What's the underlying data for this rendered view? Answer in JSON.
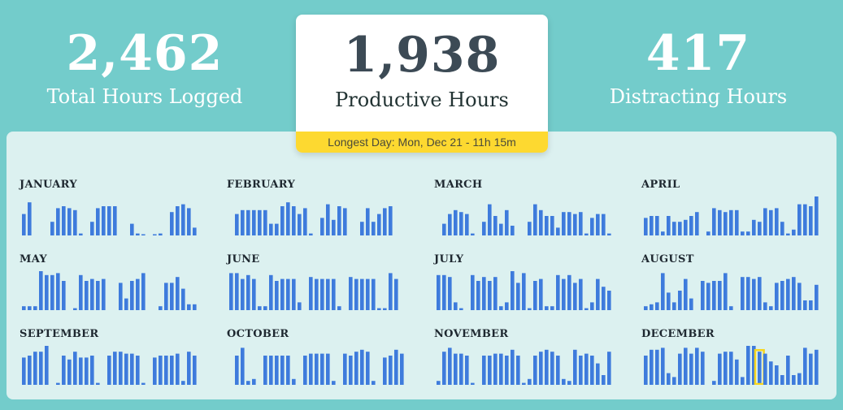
{
  "stats": {
    "total": {
      "value": "2,462",
      "label": "Total Hours Logged"
    },
    "productive": {
      "value": "1,938",
      "label": "Productive Hours",
      "longest_day": "Longest Day: Mon, Dec 21 - 11h 15m"
    },
    "distracting": {
      "value": "417",
      "label": "Distracting Hours"
    }
  },
  "colors": {
    "background": "#73cccb",
    "panel": "#dcf1f0",
    "bar": "#3e7bdc",
    "highlight": "#f7d51d",
    "banner": "#fdd930"
  },
  "highlight": {
    "month": "DECEMBER",
    "day": 21
  },
  "months": [
    {
      "name": "JANUARY",
      "values": [
        0.55,
        0.85,
        0,
        0,
        0,
        0.35,
        0.7,
        0.75,
        0.7,
        0.65,
        0.05,
        0,
        0.35,
        0.7,
        0.75,
        0.75,
        0.75,
        0,
        0,
        0.3,
        0.05,
        0.03,
        0,
        0.03,
        0.05,
        0,
        0.6,
        0.75,
        0.8,
        0.7,
        0.2
      ]
    },
    {
      "name": "FEBRUARY",
      "values": [
        0,
        0.55,
        0.65,
        0.65,
        0.65,
        0.65,
        0.65,
        0.3,
        0.3,
        0.75,
        0.85,
        0.75,
        0.55,
        0.7,
        0.05,
        0,
        0.45,
        0.8,
        0.4,
        0.75,
        0.7,
        0,
        0,
        0.35,
        0.7,
        0.35,
        0.55,
        0.7,
        0.75
      ]
    },
    {
      "name": "MARCH",
      "values": [
        0,
        0.3,
        0.55,
        0.65,
        0.6,
        0.55,
        0.05,
        0,
        0.35,
        0.8,
        0.5,
        0.3,
        0.65,
        0.25,
        0,
        0,
        0.35,
        0.8,
        0.65,
        0.5,
        0.5,
        0.2,
        0.6,
        0.6,
        0.55,
        0.6,
        0.05,
        0.45,
        0.55,
        0.55,
        0.05
      ]
    },
    {
      "name": "APRIL",
      "values": [
        0.45,
        0.5,
        0.5,
        0.1,
        0.5,
        0.35,
        0.35,
        0.4,
        0.5,
        0.6,
        0,
        0.1,
        0.7,
        0.65,
        0.6,
        0.65,
        0.65,
        0.1,
        0.1,
        0.4,
        0.35,
        0.7,
        0.65,
        0.7,
        0.35,
        0.05,
        0.15,
        0.8,
        0.8,
        0.75,
        1.0,
        0.75
      ]
    },
    {
      "name": "MAY",
      "values": [
        0.1,
        0.1,
        0.1,
        1.0,
        0.9,
        0.9,
        0.95,
        0.75,
        0,
        0.05,
        0.9,
        0.75,
        0.8,
        0.75,
        0.8,
        0,
        0,
        0.7,
        0.3,
        0.75,
        0.8,
        0.95,
        0,
        0,
        0.1,
        0.7,
        0.7,
        0.85,
        0.55,
        0.15,
        0.15
      ]
    },
    {
      "name": "JUNE",
      "values": [
        0.95,
        0.95,
        0.8,
        0.9,
        0.8,
        0.1,
        0.1,
        0.9,
        0.75,
        0.8,
        0.8,
        0.8,
        0.2,
        0,
        0.85,
        0.8,
        0.8,
        0.8,
        0.8,
        0.1,
        0,
        0.85,
        0.8,
        0.8,
        0.8,
        0.8,
        0.05,
        0.05,
        0.95,
        0.8
      ]
    },
    {
      "name": "JULY",
      "values": [
        0.9,
        0.9,
        0.85,
        0.2,
        0.05,
        0,
        0.9,
        0.75,
        0.85,
        0.75,
        0.85,
        0.1,
        0.2,
        1.0,
        0.7,
        0.95,
        0.05,
        0.75,
        0.8,
        0.1,
        0.1,
        0.9,
        0.8,
        0.9,
        0.7,
        0.8,
        0.05,
        0.2,
        0.8,
        0.6,
        0.5
      ]
    },
    {
      "name": "AUGUST",
      "values": [
        0.1,
        0.15,
        0.2,
        0.95,
        0.45,
        0.2,
        0.5,
        0.8,
        0.3,
        0,
        0.75,
        0.7,
        0.75,
        0.75,
        0.95,
        0.1,
        0,
        0.85,
        0.85,
        0.8,
        0.85,
        0.2,
        0.1,
        0.7,
        0.75,
        0.8,
        0.85,
        0.7,
        0.25,
        0.25,
        0.65
      ]
    },
    {
      "name": "SEPTEMBER",
      "values": [
        0.7,
        0.75,
        0.85,
        0.85,
        1.0,
        0,
        0.05,
        0.75,
        0.65,
        0.85,
        0.7,
        0.7,
        0.75,
        0.05,
        0,
        0.75,
        0.85,
        0.85,
        0.8,
        0.8,
        0.75,
        0.05,
        0,
        0.7,
        0.75,
        0.75,
        0.75,
        0.8,
        0.1,
        0.85,
        0.75
      ]
    },
    {
      "name": "OCTOBER",
      "values": [
        0,
        0.75,
        0.95,
        0.1,
        0.15,
        0,
        0.75,
        0.75,
        0.75,
        0.75,
        0.75,
        0.15,
        0,
        0.75,
        0.8,
        0.8,
        0.8,
        0.8,
        0.1,
        0,
        0.8,
        0.75,
        0.85,
        0.9,
        0.85,
        0.1,
        0,
        0.7,
        0.75,
        0.9,
        0.8
      ]
    },
    {
      "name": "NOVEMBER",
      "values": [
        0.1,
        0.85,
        0.95,
        0.8,
        0.8,
        0.75,
        0.05,
        0,
        0.75,
        0.75,
        0.8,
        0.8,
        0.75,
        0.9,
        0.75,
        0.05,
        0.15,
        0.75,
        0.85,
        0.9,
        0.85,
        0.75,
        0.15,
        0.1,
        0.9,
        0.75,
        0.8,
        0.75,
        0.55,
        0.25,
        0.85
      ]
    },
    {
      "name": "DECEMBER",
      "values": [
        0.75,
        0.9,
        0.9,
        0.95,
        0.3,
        0.2,
        0.8,
        0.95,
        0.8,
        0.95,
        0.85,
        0,
        0.1,
        0.8,
        0.85,
        0.85,
        0.65,
        0.2,
        1.0,
        1.0,
        0.85,
        0.8,
        0.6,
        0.5,
        0.25,
        0.75,
        0.25,
        0.3,
        0.95,
        0.8,
        0.9
      ]
    }
  ]
}
